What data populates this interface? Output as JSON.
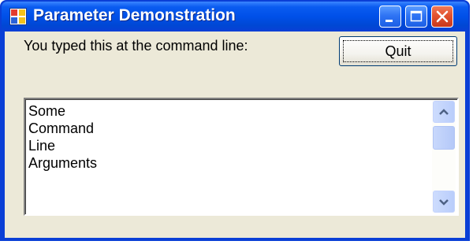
{
  "window": {
    "title": "Parameter Demonstration",
    "icon": "app-icon",
    "controls": [
      "minimize-icon",
      "maximize-icon",
      "close-icon"
    ]
  },
  "content": {
    "prompt_label": "You typed this at the command line:",
    "quit_label": "Quit",
    "listbox_items": [
      "Some",
      "Command",
      "Line",
      "Arguments"
    ]
  },
  "colors": {
    "titlebar": "#0050e8",
    "client_background": "#ece9d8",
    "close_button": "#e2522f",
    "scrollbar_button": "#b9cdfb"
  }
}
